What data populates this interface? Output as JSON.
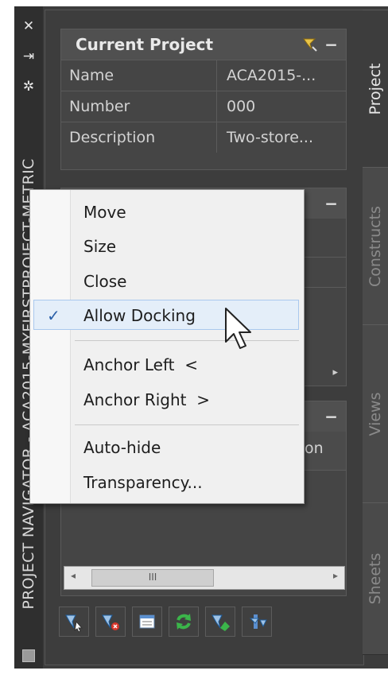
{
  "titlebar": {
    "close_glyph": "✕",
    "autohide_glyph": "⇥",
    "props_glyph": "✲",
    "vertical_title": "PROJECT NAVIGATOR - ACA2015-MYFIRSTPROJECT-METRIC"
  },
  "current_project": {
    "title": "Current Project",
    "minimize_glyph": "−",
    "rows": [
      {
        "key": "Name",
        "value": "ACA2015-..."
      },
      {
        "key": "Number",
        "value": "000"
      },
      {
        "key": "Description",
        "value": "Two-store..."
      }
    ]
  },
  "hidden_section": {
    "minimize_glyph": "−",
    "partial_text": "on",
    "arrow": "▸"
  },
  "tabs": [
    "Project",
    "Constructs",
    "Views",
    "Sheets"
  ],
  "active_tab": "Project",
  "scrollbar": {
    "left_arrow": "◂",
    "right_arrow": "▸",
    "grip": "III"
  },
  "toolbar_icons": [
    "project-browser-icon",
    "close-project-icon",
    "properties-icon",
    "refresh-icon",
    "repath-icon",
    "sync-icon"
  ],
  "context_menu": {
    "items": [
      {
        "label": "Move",
        "checked": false
      },
      {
        "label": "Size",
        "checked": false
      },
      {
        "label": "Close",
        "checked": false
      },
      {
        "label": "Allow Docking",
        "checked": true,
        "check_glyph": "✓"
      },
      {
        "label": "Anchor Left  <",
        "checked": false
      },
      {
        "label": "Anchor Right  >",
        "checked": false
      },
      {
        "label": "Auto-hide",
        "checked": false
      },
      {
        "label": "Transparency...",
        "checked": false
      }
    ]
  },
  "colors": {
    "accent_check": "#2a5fa8",
    "highlight": "#e4eef9",
    "refresh_green": "#3bb54a"
  }
}
